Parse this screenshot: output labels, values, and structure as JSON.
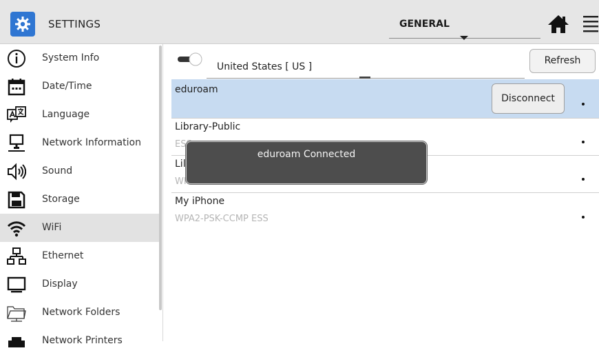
{
  "header": {
    "title": "SETTINGS",
    "tab_label": "GENERAL",
    "icons": {
      "app": "gear-icon",
      "home": "home-icon",
      "menu": "hamburger-menu-icon"
    },
    "accent_color": "#2f76d2"
  },
  "sidebar": {
    "items": [
      {
        "label": "System Info",
        "icon": "info-icon"
      },
      {
        "label": "Date/Time",
        "icon": "calendar-icon"
      },
      {
        "label": "Language",
        "icon": "language-icon"
      },
      {
        "label": "Network Information",
        "icon": "monitor-network-icon"
      },
      {
        "label": "Sound",
        "icon": "speaker-icon"
      },
      {
        "label": "Storage",
        "icon": "floppy-disk-icon"
      },
      {
        "label": "WiFi",
        "icon": "wifi-icon",
        "active": true
      },
      {
        "label": "Ethernet",
        "icon": "ethernet-icon"
      },
      {
        "label": "Display",
        "icon": "display-icon"
      },
      {
        "label": "Network Folders",
        "icon": "folder-icon"
      },
      {
        "label": "Network Printers",
        "icon": "printer-icon"
      }
    ]
  },
  "wifi": {
    "toggle_on": true,
    "country": "United States [ US ]",
    "refresh_label": "Refresh",
    "disconnect_label": "Disconnect",
    "networks": [
      {
        "name": "eduroam",
        "security": "",
        "connected": true
      },
      {
        "name": "Library-Public",
        "security": "ESS",
        "connected": false
      },
      {
        "name": "Lil",
        "security": "WPA2-PSK-CCMP ESS",
        "connected": false
      },
      {
        "name": "My iPhone",
        "security": "WPA2-PSK-CCMP ESS",
        "connected": false
      }
    ],
    "connected_highlight": "#c7dbf1"
  },
  "toast": {
    "message": "eduroam Connected"
  }
}
